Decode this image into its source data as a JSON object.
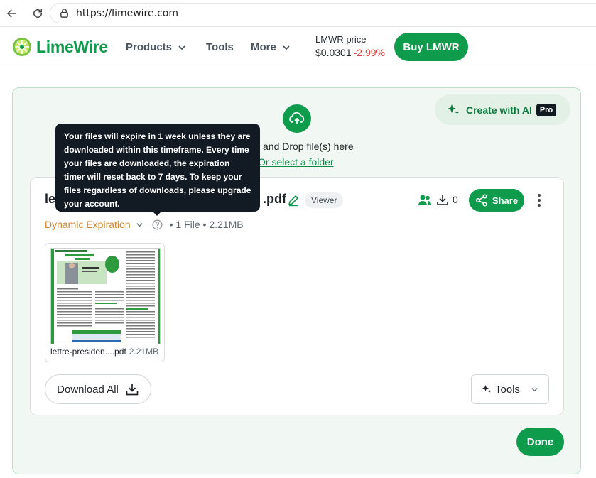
{
  "browser": {
    "url": "https://limewire.com"
  },
  "header": {
    "logo_text": "LimeWire",
    "nav": [
      {
        "label": "Products"
      },
      {
        "label": "Tools"
      },
      {
        "label": "More"
      }
    ],
    "price_label": "LMWR price",
    "price_value": "$0.0301",
    "price_change": "-2.99%",
    "buy_label": "Buy LMWR"
  },
  "upload": {
    "create_ai_label": "Create with AI",
    "pro_badge": "Pro",
    "drop_text": "and Drop file(s) here",
    "folder_link": "Or select a folder"
  },
  "file_card": {
    "title_start": "le",
    "title_end": ".pdf",
    "viewer_badge": "Viewer",
    "download_count": "0",
    "share_label": "Share",
    "expiration_label": "Dynamic Expiration",
    "meta": "• 1 File • 2.21MB",
    "thumbnail": {
      "name": "lettre-presiden....pdf",
      "size": "2.21MB"
    },
    "download_all_label": "Download All",
    "tools_label": "Tools",
    "done_label": "Done"
  },
  "tooltip": {
    "text": "Your files will expire in 1 week unless they are downloaded within this timeframe. Every time your files are downloaded, the expiration timer will reset back to 7 days. To keep your files regardless of downloads, please upgrade your account."
  },
  "colors": {
    "brand": "#0e9b4c",
    "price_down": "#e0403a",
    "expiration": "#d4862b",
    "tooltip_bg": "#121a24"
  }
}
